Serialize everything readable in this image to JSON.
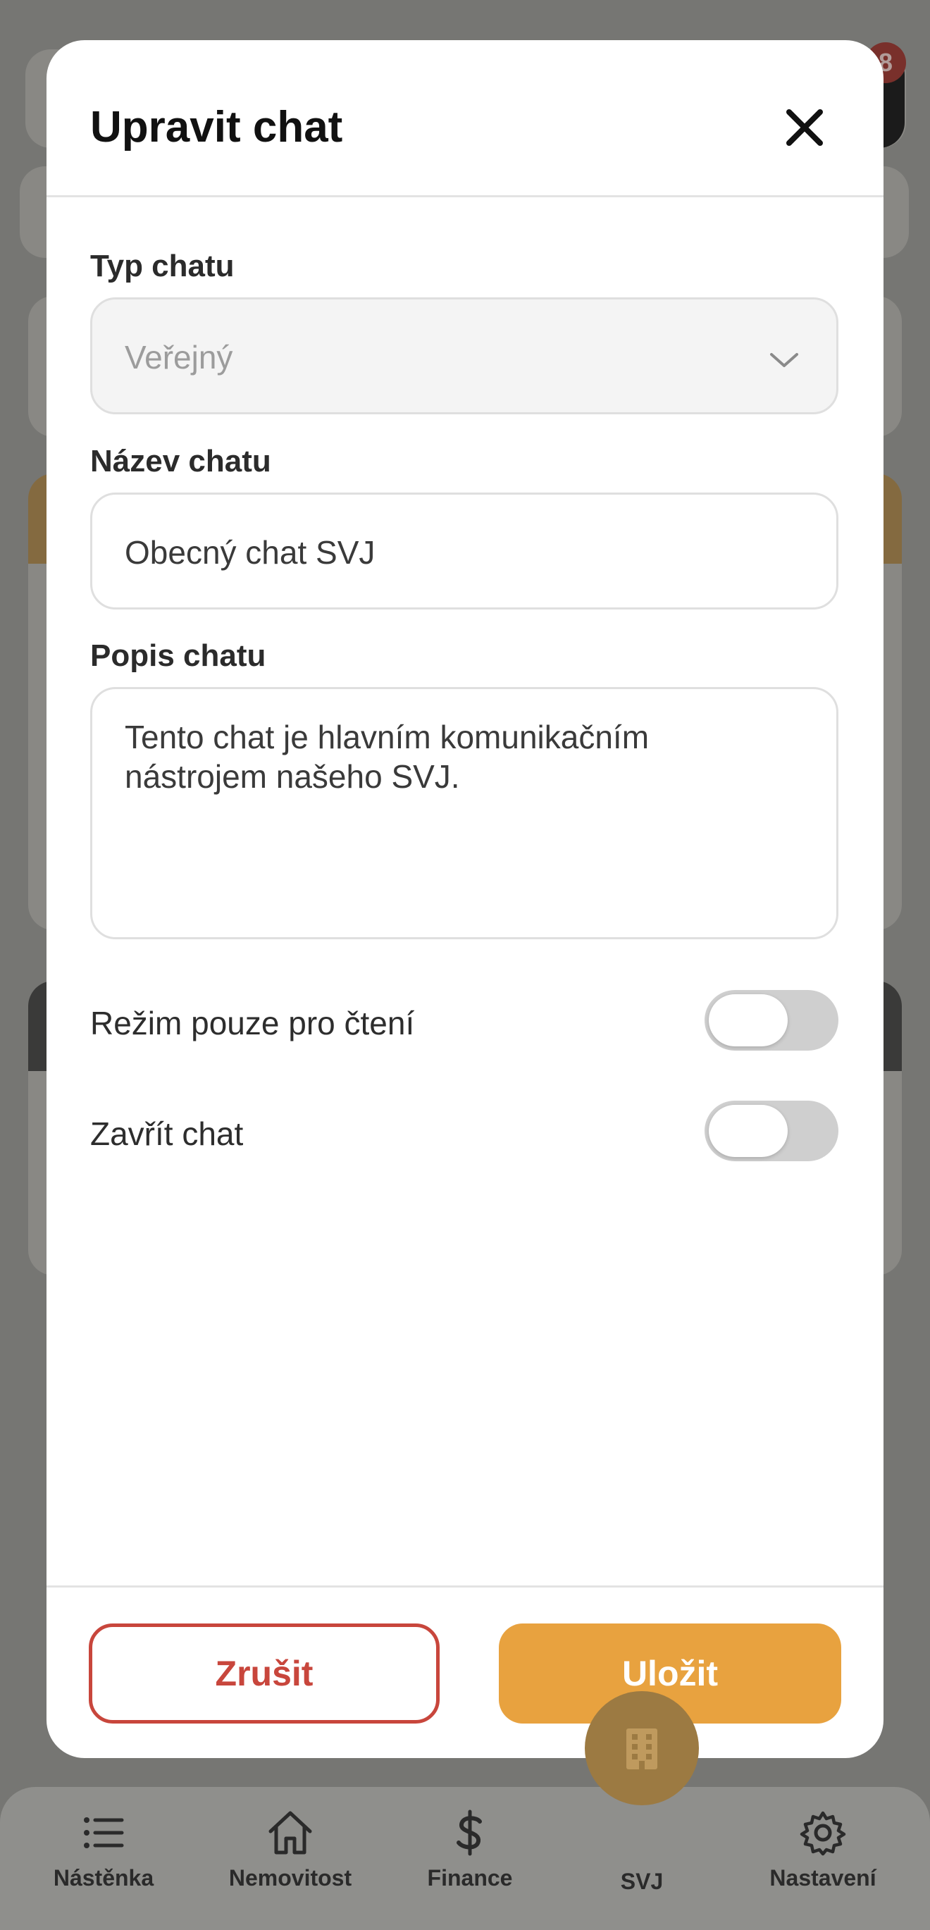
{
  "modal": {
    "title": "Upravit chat",
    "chat_type": {
      "label": "Typ chatu",
      "value": "Veřejný"
    },
    "chat_name": {
      "label": "Název chatu",
      "value": "Obecný chat SVJ"
    },
    "chat_description": {
      "label": "Popis chatu",
      "value": "Tento chat je hlavním komunikačním\nnástrojem našeho SVJ."
    },
    "toggles": [
      {
        "label": "Režim pouze pro čtení",
        "on": false
      },
      {
        "label": "Zavřít chat",
        "on": false
      }
    ],
    "cancel_label": "Zrušit",
    "save_label": "Uložit"
  },
  "background": {
    "badge_count": "8"
  },
  "tabbar": {
    "items": [
      {
        "label": "Nástěnka",
        "icon": "list-icon"
      },
      {
        "label": "Nemovitost",
        "icon": "home-icon"
      },
      {
        "label": "Finance",
        "icon": "dollar-icon"
      },
      {
        "label": "SVJ",
        "icon": "building-icon",
        "active": true
      },
      {
        "label": "Nastavení",
        "icon": "gear-icon"
      }
    ]
  },
  "colors": {
    "accent": "#e8a23f",
    "danger": "#c8463c"
  }
}
